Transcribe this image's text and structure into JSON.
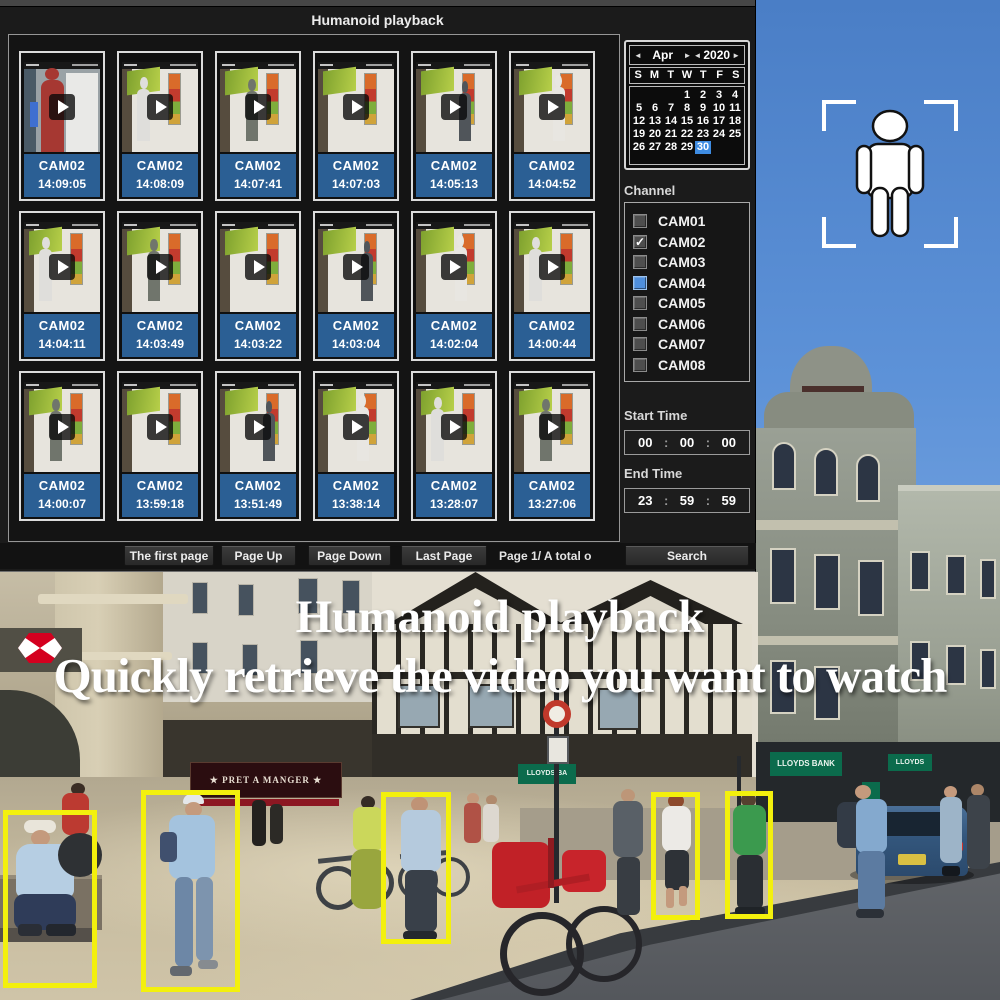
{
  "window": {
    "title": "Humanoid playback"
  },
  "overlay": {
    "title": "Humanoid playback",
    "subtitle": "Quickly retrieve the video you want to watch"
  },
  "thumbnails": {
    "items": [
      {
        "cam": "CAM02",
        "time": "14:09:05"
      },
      {
        "cam": "CAM02",
        "time": "14:08:09"
      },
      {
        "cam": "CAM02",
        "time": "14:07:41"
      },
      {
        "cam": "CAM02",
        "time": "14:07:03"
      },
      {
        "cam": "CAM02",
        "time": "14:05:13"
      },
      {
        "cam": "CAM02",
        "time": "14:04:52"
      },
      {
        "cam": "CAM02",
        "time": "14:04:11"
      },
      {
        "cam": "CAM02",
        "time": "14:03:49"
      },
      {
        "cam": "CAM02",
        "time": "14:03:22"
      },
      {
        "cam": "CAM02",
        "time": "14:03:04"
      },
      {
        "cam": "CAM02",
        "time": "14:02:04"
      },
      {
        "cam": "CAM02",
        "time": "14:00:44"
      },
      {
        "cam": "CAM02",
        "time": "14:00:07"
      },
      {
        "cam": "CAM02",
        "time": "13:59:18"
      },
      {
        "cam": "CAM02",
        "time": "13:51:49"
      },
      {
        "cam": "CAM02",
        "time": "13:38:14"
      },
      {
        "cam": "CAM02",
        "time": "13:28:07"
      },
      {
        "cam": "CAM02",
        "time": "13:27:06"
      }
    ]
  },
  "calendar": {
    "month": "Apr",
    "year": "2020",
    "prev_arrow": "◄",
    "next_arrow": "►",
    "day_headers": [
      "S",
      "M",
      "T",
      "W",
      "T",
      "F",
      "S"
    ],
    "weeks": [
      [
        "",
        "",
        "",
        "1",
        "2",
        "3",
        "4"
      ],
      [
        "5",
        "6",
        "7",
        "8",
        "9",
        "10",
        "11"
      ],
      [
        "12",
        "13",
        "14",
        "15",
        "16",
        "17",
        "18"
      ],
      [
        "19",
        "20",
        "21",
        "22",
        "23",
        "24",
        "25"
      ],
      [
        "26",
        "27",
        "28",
        "29",
        "30",
        "",
        ""
      ]
    ],
    "selected_day": "30"
  },
  "channel_section": {
    "label": "Channel"
  },
  "channels": [
    {
      "label": "CAM01",
      "state": "unchecked"
    },
    {
      "label": "CAM02",
      "state": "checked"
    },
    {
      "label": "CAM03",
      "state": "unchecked"
    },
    {
      "label": "CAM04",
      "state": "highlighted"
    },
    {
      "label": "CAM05",
      "state": "unchecked"
    },
    {
      "label": "CAM06",
      "state": "unchecked"
    },
    {
      "label": "CAM07",
      "state": "unchecked"
    },
    {
      "label": "CAM08",
      "state": "unchecked"
    }
  ],
  "start_time": {
    "label": "Start Time",
    "h": "00",
    "m": "00",
    "s": "00",
    "sep": ":"
  },
  "end_time": {
    "label": "End Time",
    "h": "23",
    "m": "59",
    "s": "59",
    "sep": ":"
  },
  "pagination": {
    "first": "The first page",
    "page_up": "Page Up",
    "page_down": "Page Down",
    "last": "Last Page",
    "status": "Page 1/ A total o",
    "search": "Search"
  },
  "signs": {
    "pret": "★ PRET A MANGER ★",
    "lloyds_left": "LLOYDS BA",
    "lloyds_right": "LLOYDS BANK",
    "lloyds_far": "LLOYDS"
  },
  "icons": {
    "play": "▶",
    "check": "✓",
    "humanoid": "person-in-detection-frame"
  },
  "colors": {
    "thumb_label_blue": "#2b5f94",
    "calendar_selected_blue": "#3e8ce2",
    "channel_highlight_blue": "#4f8fdd",
    "detection_yellow": "#f3f00d",
    "lloyds_green": "#0b6b4c",
    "hsbc_red": "#d4001f"
  }
}
